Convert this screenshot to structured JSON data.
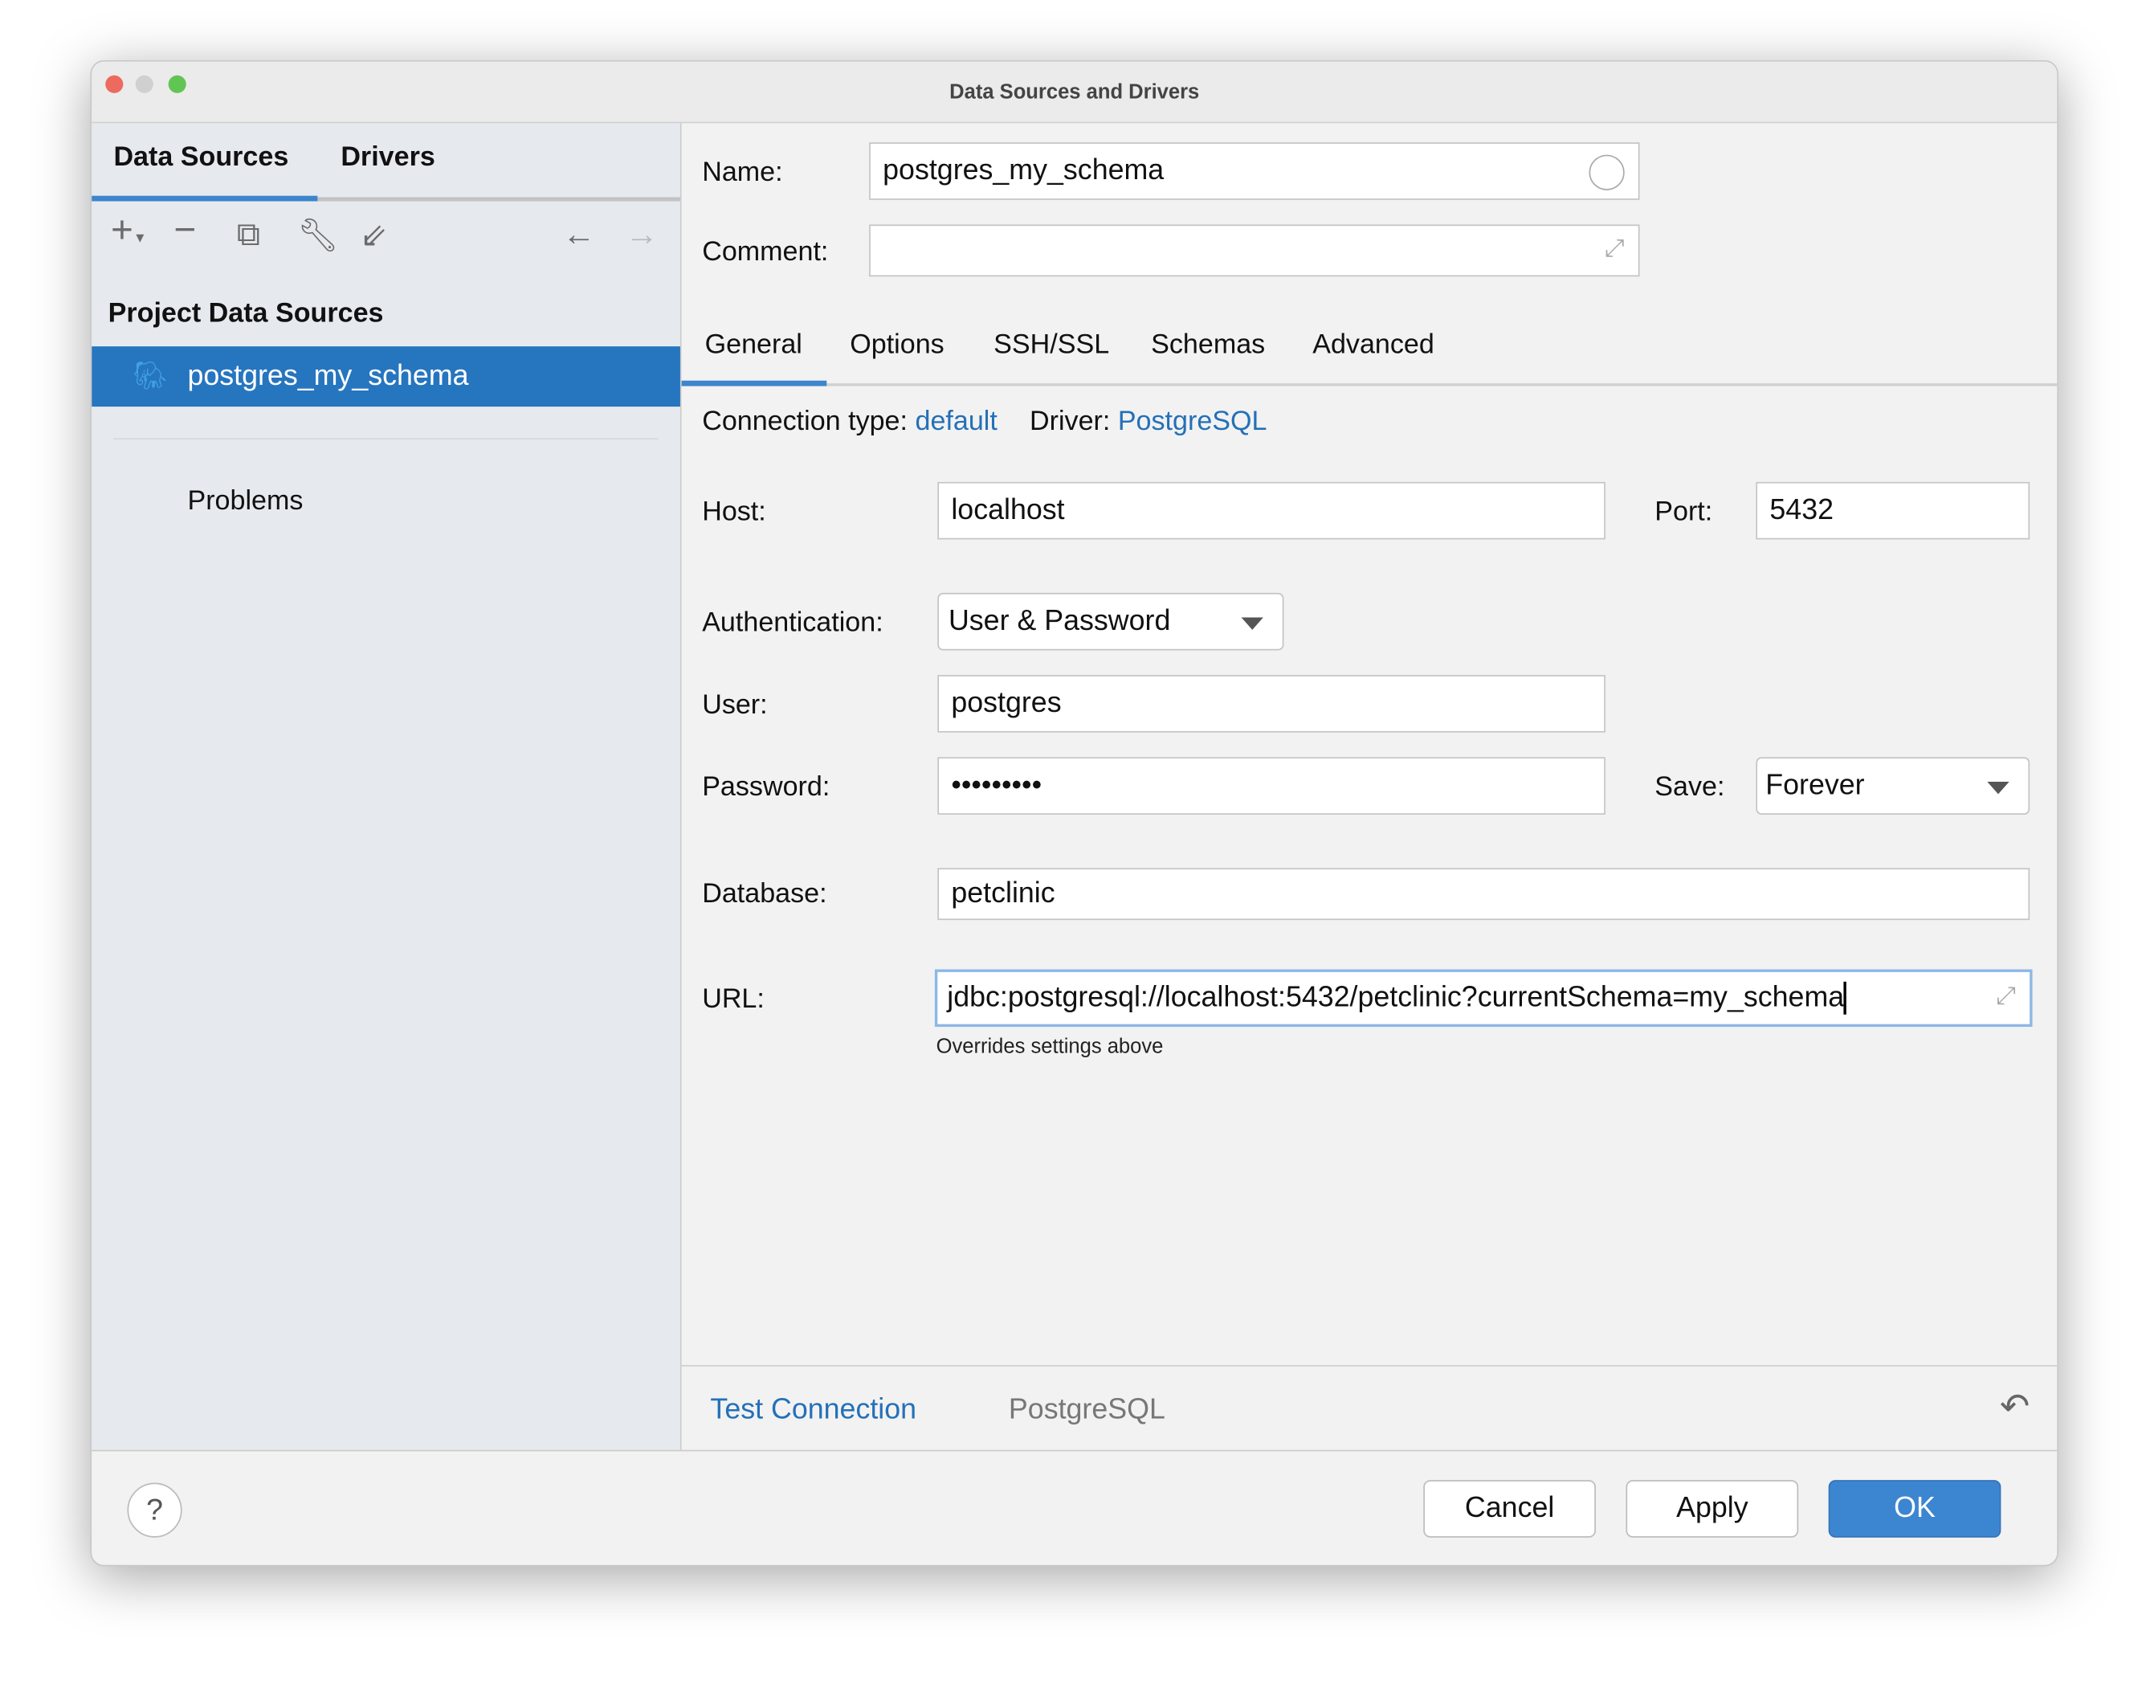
{
  "window": {
    "title": "Data Sources and Drivers"
  },
  "sidebar": {
    "tabs": [
      "Data Sources",
      "Drivers"
    ],
    "section_title": "Project Data Sources",
    "items": [
      {
        "label": "postgres_my_schema"
      }
    ],
    "problems_label": "Problems"
  },
  "form": {
    "name_label": "Name:",
    "name_value": "postgres_my_schema",
    "comment_label": "Comment:",
    "comment_value": "",
    "tabs": [
      "General",
      "Options",
      "SSH/SSL",
      "Schemas",
      "Advanced"
    ],
    "connection_type_label": "Connection type:",
    "connection_type_value": "default",
    "driver_label": "Driver:",
    "driver_value": "PostgreSQL",
    "host_label": "Host:",
    "host_value": "localhost",
    "port_label": "Port:",
    "port_value": "5432",
    "auth_label": "Authentication:",
    "auth_value": "User & Password",
    "user_label": "User:",
    "user_value": "postgres",
    "password_label": "Password:",
    "password_value": "•••••••••",
    "save_label": "Save:",
    "save_value": "Forever",
    "database_label": "Database:",
    "database_value": "petclinic",
    "url_label": "URL:",
    "url_value": "jdbc:postgresql://localhost:5432/petclinic?currentSchema=my_schema",
    "url_hint": "Overrides settings above"
  },
  "bottom": {
    "test_connection": "Test Connection",
    "driver_name": "PostgreSQL"
  },
  "footer": {
    "help": "?",
    "cancel": "Cancel",
    "apply": "Apply",
    "ok": "OK"
  }
}
